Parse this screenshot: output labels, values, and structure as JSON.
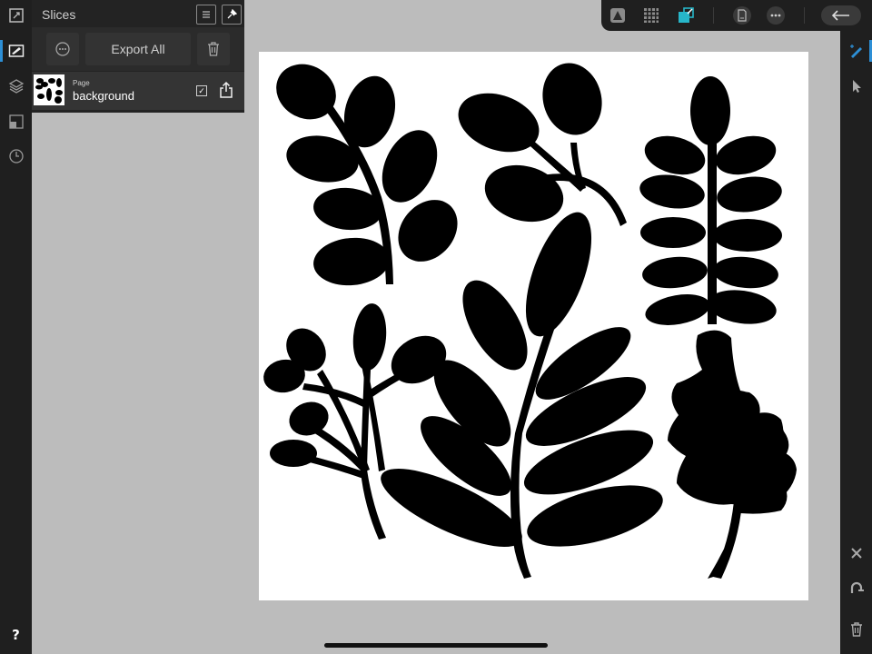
{
  "panel": {
    "title": "Slices",
    "export_all_label": "Export All",
    "slice": {
      "type_label": "Page",
      "name": "background",
      "checked": "✓"
    }
  },
  "help": {
    "label": "?"
  },
  "icons": {
    "left_toolbar": [
      "resize-icon",
      "slices-icon",
      "layers-icon",
      "transform-icon",
      "history-icon"
    ],
    "top_toolbar": [
      "persona-icon",
      "pixel-grid-icon",
      "export-persona-icon",
      "document-icon",
      "more-icon",
      "back-arrow-icon"
    ],
    "right_toolbar": [
      "slice-tool-icon",
      "move-tool-icon",
      "close-icon",
      "snapping-icon",
      "trash-icon"
    ]
  },
  "colors": {
    "accent": "#2d8fd6",
    "toolbar": "#1f1f1f",
    "workspace": "#bcbcbc",
    "artwork": "#000000"
  }
}
